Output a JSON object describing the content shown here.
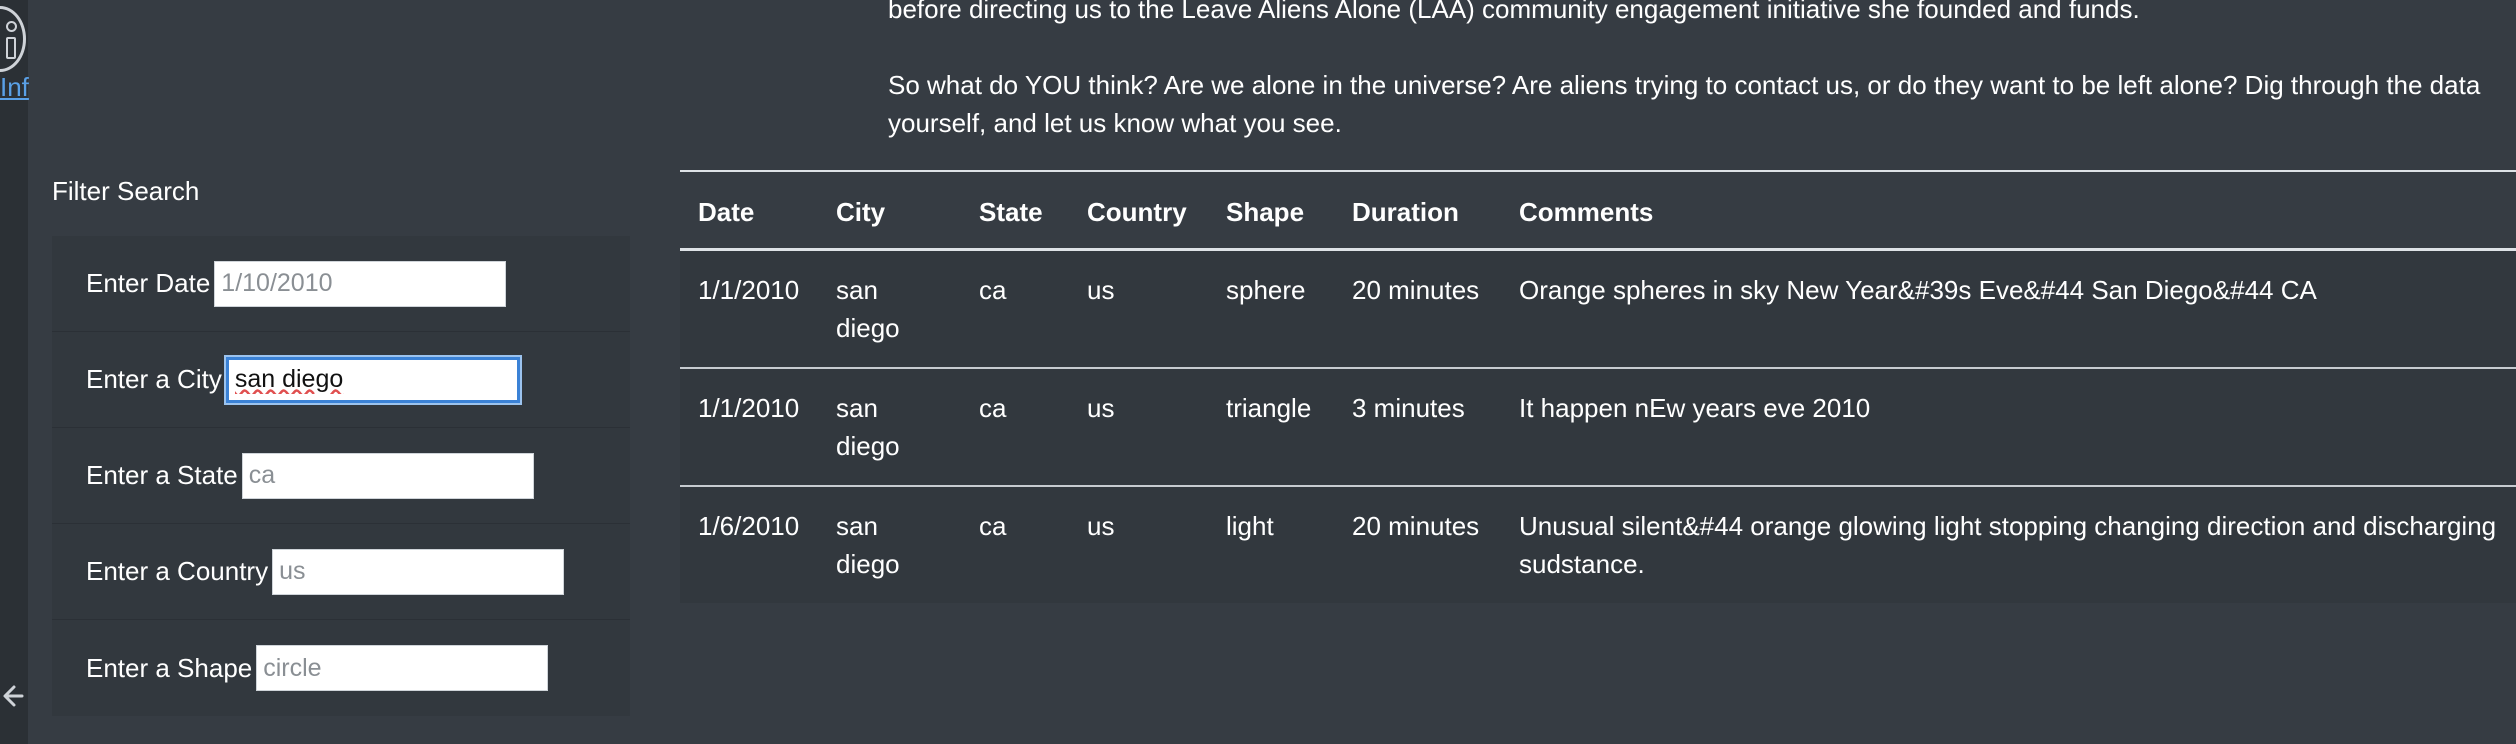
{
  "sidebar": {
    "info_label": "Inf"
  },
  "intro": {
    "paragraph_1": "before directing us to the Leave Aliens Alone (LAA) community engagement initiative she founded and funds.",
    "paragraph_2": "So what do YOU think? Are we alone in the universe? Are aliens trying to contact us, or do they want to be left alone? Dig through the data yourself, and let us know what you see."
  },
  "filters": {
    "title": "Filter Search",
    "items": [
      {
        "label": "Enter Date",
        "placeholder": "1/10/2010",
        "value": ""
      },
      {
        "label": "Enter a City",
        "placeholder": "",
        "value": "san diego"
      },
      {
        "label": "Enter a State",
        "placeholder": "ca",
        "value": ""
      },
      {
        "label": "Enter a Country",
        "placeholder": "us",
        "value": ""
      },
      {
        "label": "Enter a Shape",
        "placeholder": "circle",
        "value": ""
      }
    ]
  },
  "table": {
    "headers": [
      "Date",
      "City",
      "State",
      "Country",
      "Shape",
      "Duration",
      "Comments"
    ],
    "rows": [
      [
        "1/1/2010",
        "san diego",
        "ca",
        "us",
        "sphere",
        "20 minutes",
        "Orange spheres in sky New Year&#39s Eve&#44 San Diego&#44 CA"
      ],
      [
        "1/1/2010",
        "san diego",
        "ca",
        "us",
        "triangle",
        "3 minutes",
        "It happen nEw years eve 2010"
      ],
      [
        "1/6/2010",
        "san diego",
        "ca",
        "us",
        "light",
        "20 minutes",
        "Unusual silent&#44 orange glowing light stopping changing direction and discharging sudstance."
      ]
    ]
  },
  "colors": {
    "page_background": "#363c43",
    "table_row_background": "#32383e",
    "focus_ring": "#3b82d6",
    "link": "#5aa0e6"
  },
  "icons": {
    "info": "info-icon",
    "back": "back-arrow-icon"
  }
}
